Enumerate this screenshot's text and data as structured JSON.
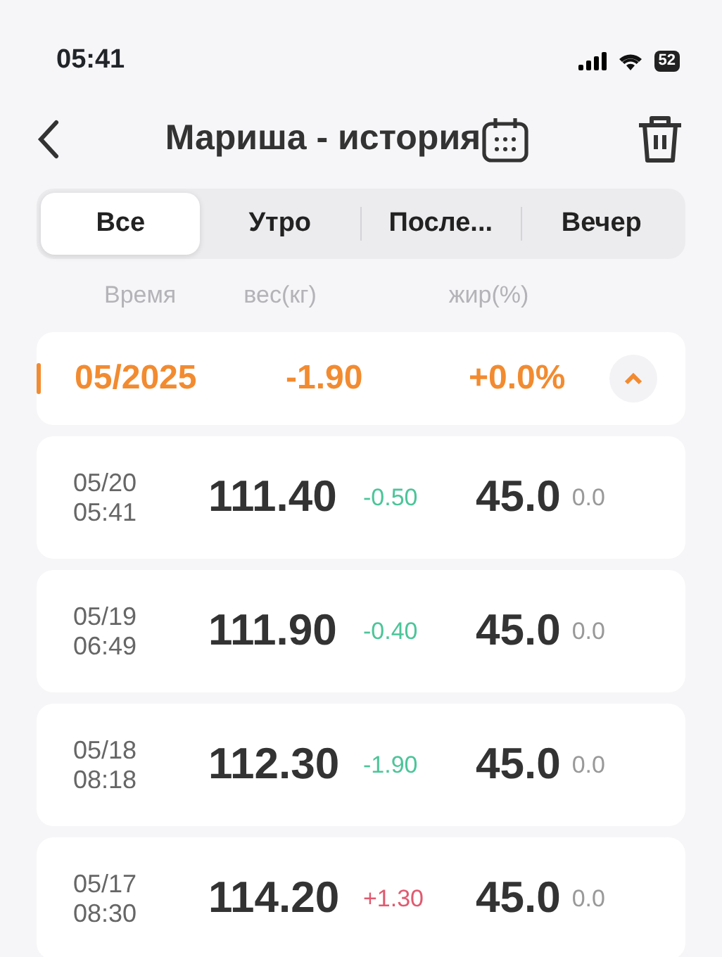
{
  "status_bar": {
    "time": "05:41",
    "battery": "52"
  },
  "header": {
    "title": "Мариша - история"
  },
  "tabs": [
    {
      "label": "Все",
      "selected": true
    },
    {
      "label": "Утро",
      "selected": false
    },
    {
      "label": "После...",
      "selected": false
    },
    {
      "label": "Вечер",
      "selected": false
    }
  ],
  "columns": [
    "Время",
    "вес(кг)",
    "жир(%)"
  ],
  "month": {
    "label": "05/2025",
    "weight_change": "-1.90",
    "fat_change": "+0.0%",
    "expanded": true
  },
  "records": [
    {
      "date": "05/20",
      "time": "05:41",
      "weight": "111.40",
      "weight_change": "-0.50",
      "color": "#4cc59a",
      "fat": "45.0",
      "fat_change": "0.0"
    },
    {
      "date": "05/19",
      "time": "06:49",
      "weight": "111.90",
      "weight_change": "-0.40",
      "color": "#4cc59a",
      "fat": "45.0",
      "fat_change": "0.0"
    },
    {
      "date": "05/18",
      "time": "08:18",
      "weight": "112.30",
      "weight_change": "-1.90",
      "color": "#4cc59a",
      "fat": "45.0",
      "fat_change": "0.0"
    },
    {
      "date": "05/17",
      "time": "08:30",
      "weight": "114.20",
      "weight_change": "+1.30",
      "color": "#e05a70",
      "fat": "45.0",
      "fat_change": "0.0"
    }
  ]
}
